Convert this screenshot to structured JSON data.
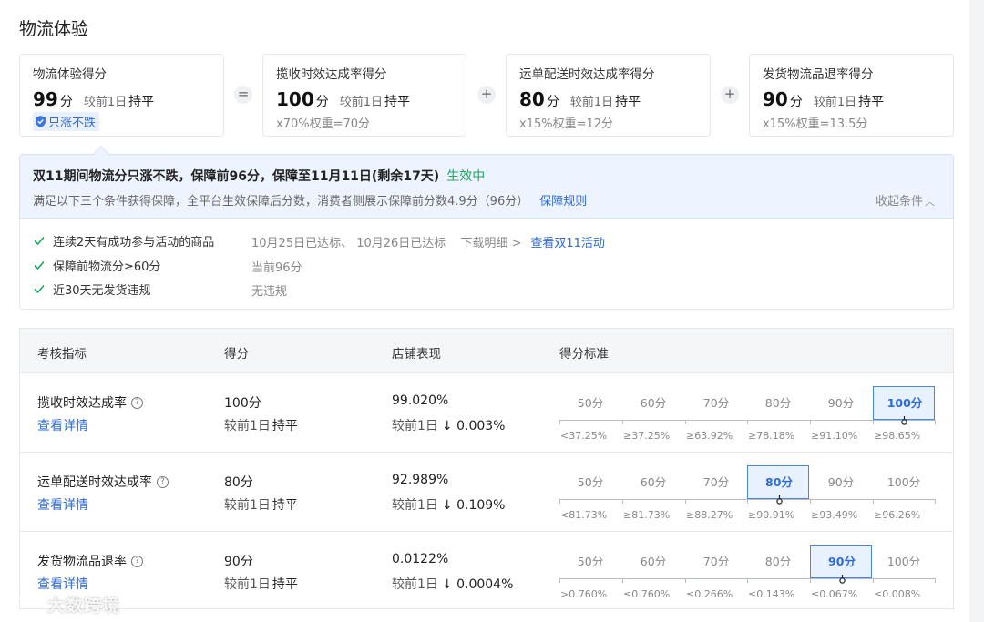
{
  "page": {
    "title": "物流体验"
  },
  "cards": [
    {
      "title": "物流体验得分",
      "score": "99",
      "unit": "分",
      "cmp_label": "较前1日",
      "cmp_value": "持平",
      "badge": "只涨不跌"
    },
    {
      "title": "揽收时效达成率得分",
      "score": "100",
      "unit": "分",
      "cmp_label": "较前1日",
      "cmp_value": "持平",
      "weight": "x70%权重=70分"
    },
    {
      "title": "运单配送时效达成率得分",
      "score": "80",
      "unit": "分",
      "cmp_label": "较前1日",
      "cmp_value": "持平",
      "weight": "x15%权重=12分"
    },
    {
      "title": "发货物流品退率得分",
      "score": "90",
      "unit": "分",
      "cmp_label": "较前1日",
      "cmp_value": "持平",
      "weight": "x15%权重=13.5分"
    }
  ],
  "operators": [
    "=",
    "+",
    "+"
  ],
  "banner": {
    "title": "双11期间物流分只涨不跌，保障前96分，保障至11月11日(剩余17天)",
    "status": "生效中",
    "status_color": "#19a95c",
    "desc": "满足以下三个条件获得保障，全平台生效保障后分数，消费者侧展示保障前分数4.9分（96分）",
    "rule_link": "保障规则",
    "collapse": "收起条件"
  },
  "conditions": [
    {
      "label": "连续2天有成功参与活动的商品",
      "value": "10月25日已达标、 10月26日已达标",
      "download": "下载明细 >",
      "link": "查看双11活动"
    },
    {
      "label": "保障前物流分≥60分",
      "value": "当前96分"
    },
    {
      "label": "近30天无发货违规",
      "value": "无违规"
    }
  ],
  "table": {
    "headers": [
      "考核指标",
      "得分",
      "店铺表现",
      "得分标准"
    ],
    "scale_labels": [
      "50分",
      "60分",
      "70分",
      "80分",
      "90分",
      "100分"
    ],
    "rows": [
      {
        "name": "揽收时效达成率",
        "help_icon": "?",
        "detail": "查看详情",
        "score": "100分",
        "score_cmp_label": "较前1日",
        "score_cmp_value": "持平",
        "perf": "99.020%",
        "perf_cmp_label": "较前1日",
        "perf_cmp_value": "↓ 0.003%",
        "active_index": 5,
        "thresholds": [
          "<37.25%",
          "≥37.25%",
          "≥63.92%",
          "≥78.18%",
          "≥91.10%",
          "≥98.65%"
        ]
      },
      {
        "name": "运单配送时效达成率",
        "help_icon": "?",
        "detail": "查看详情",
        "score": "80分",
        "score_cmp_label": "较前1日",
        "score_cmp_value": "持平",
        "perf": "92.989%",
        "perf_cmp_label": "较前1日",
        "perf_cmp_value": "↓ 0.109%",
        "active_index": 3,
        "thresholds": [
          "<81.73%",
          "≥81.73%",
          "≥88.27%",
          "≥90.91%",
          "≥93.49%",
          "≥96.26%"
        ]
      },
      {
        "name": "发货物流品退率",
        "help_icon": "?",
        "detail": "查看详情",
        "score": "90分",
        "score_cmp_label": "较前1日",
        "score_cmp_value": "持平",
        "perf": "0.0122%",
        "perf_cmp_label": "较前1日",
        "perf_cmp_value": "↓ 0.0004%",
        "active_index": 4,
        "thresholds": [
          ">0.760%",
          "≤0.760%",
          "≤0.266%",
          "≤0.143%",
          "≤0.067%",
          "≤0.008%"
        ]
      }
    ]
  },
  "watermark": {
    "text": "大数跨境",
    "icon": "smile-logo-icon"
  },
  "colors": {
    "link": "#2f6bd8",
    "active_bg": "#e8f1fe",
    "banner_bg": "#eef4ff"
  }
}
